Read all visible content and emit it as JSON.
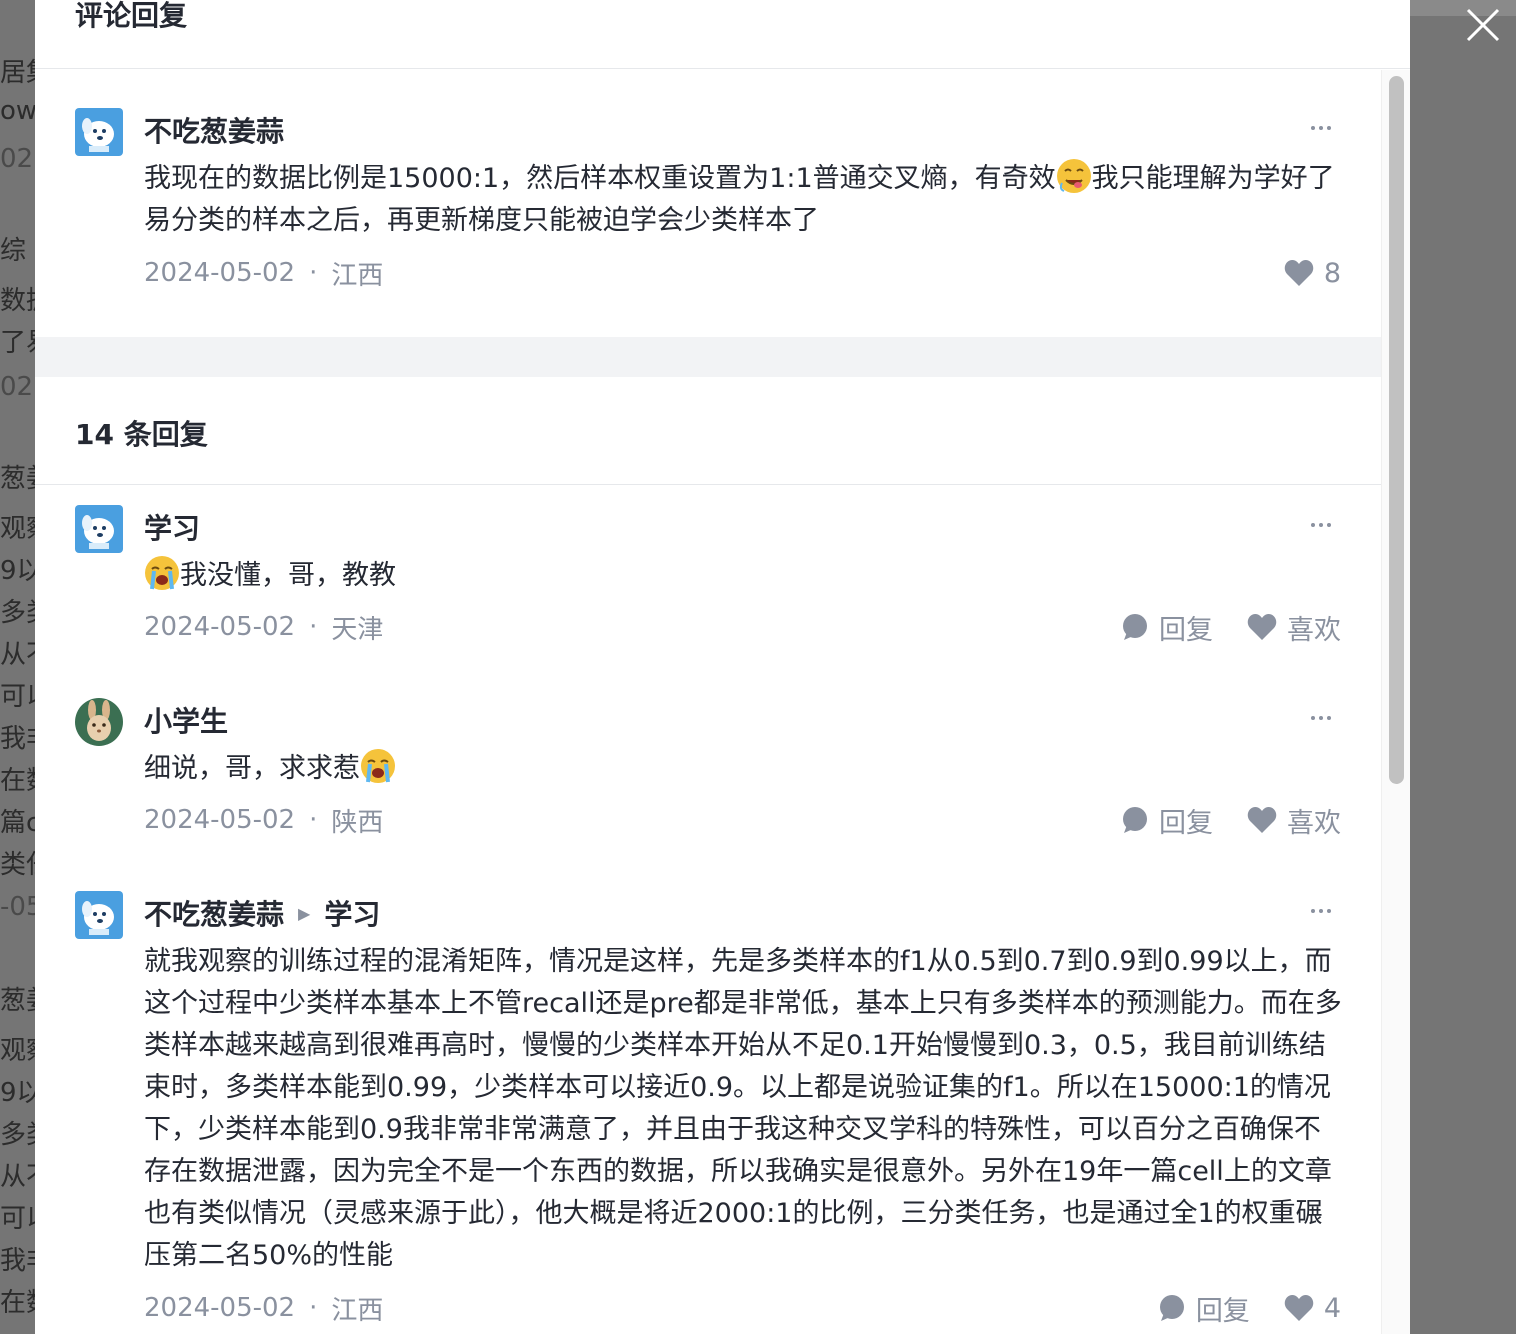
{
  "modal": {
    "title": "评论回复",
    "replies_label": "14 条回复"
  },
  "background_fragments": [
    "居集",
    "ow",
    "02",
    "综",
    "数据",
    "了易",
    "02",
    "葱姜",
    "观察",
    "9以",
    "多类",
    "从不",
    "可以",
    "我非",
    "在数",
    "篇c",
    "类任",
    "-05",
    "葱姜",
    "观察",
    "9以",
    "多类",
    "从不",
    "可以",
    "我非",
    "在数"
  ],
  "main_comment": {
    "user": "不吃葱姜蒜",
    "avatar": "cartoon-dog-avatar",
    "text_before_emoji": "我现在的数据比例是15000:1，然后样本权重设置为1:1普通交叉熵，有奇效",
    "emoji": "drooling-face-emoji",
    "text_after_emoji": "我只能理解为学好了易分类的样本之后，再更新梯度只能被迫学会少类样本了",
    "date": "2024-05-02",
    "location": "江西",
    "likes": "8"
  },
  "replies": [
    {
      "user": "学习",
      "avatar": "cartoon-dog-avatar",
      "emoji_before": "loudly-crying-face-emoji",
      "text": "我没懂，哥，教教",
      "date": "2024-05-02",
      "location": "天津",
      "reply_label": "回复",
      "like_label": "喜欢"
    },
    {
      "user": "小学生",
      "avatar": "bunny-avatar",
      "text": "细说，哥，求求惹",
      "emoji_after": "loudly-crying-face-emoji",
      "date": "2024-05-02",
      "location": "陕西",
      "reply_label": "回复",
      "like_label": "喜欢"
    },
    {
      "user": "不吃葱姜蒜",
      "reply_to": "学习",
      "avatar": "cartoon-dog-avatar",
      "text": "就我观察的训练过程的混淆矩阵，情况是这样，先是多类样本的f1从0.5到0.7到0.9到0.99以上，而这个过程中少类样本基本上不管recall还是pre都是非常低，基本上只有多类样本的预测能力。而在多类样本越来越高到很难再高时，慢慢的少类样本开始从不足0.1开始慢慢到0.3，0.5，我目前训练结束时，多类样本能到0.99，少类样本可以接近0.9。以上都是说验证集的f1。所以在15000:1的情况下，少类样本能到0.9我非常非常满意了，并且由于我这种交叉学科的特殊性，可以百分之百确保不存在数据泄露，因为完全不是一个东西的数据，所以我确实是很意外。另外在19年一篇cell上的文章也有类似情况（灵感来源于此），他大概是将近2000:1的比例，三分类任务，也是通过全1的权重碾压第二名50%的性能",
      "date": "2024-05-02",
      "location": "江西",
      "reply_label": "回复",
      "likes": "4"
    }
  ],
  "colors": {
    "overlay": "#757575",
    "text_primary": "#252933",
    "text_secondary": "#8a919f",
    "band": "#f2f3f5"
  }
}
